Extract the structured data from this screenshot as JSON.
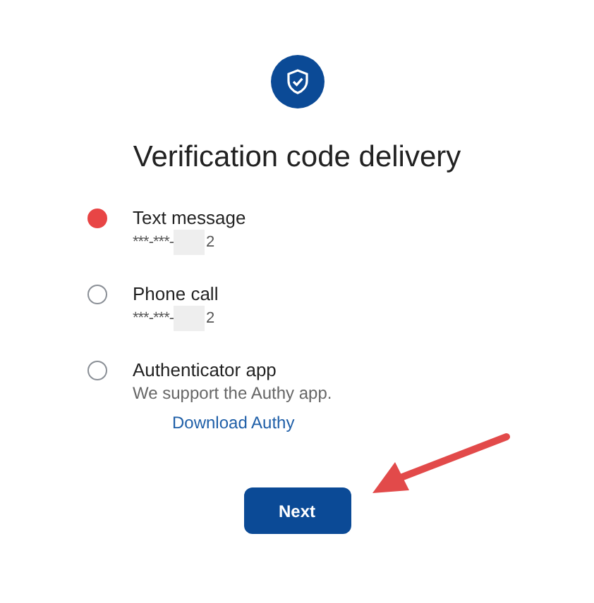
{
  "title": "Verification code delivery",
  "options": [
    {
      "label": "Text message",
      "selected": true,
      "detail": {
        "prefix": "***-***-",
        "redacted": true,
        "suffix": "2"
      }
    },
    {
      "label": "Phone call",
      "selected": false,
      "detail": {
        "prefix": "***-***-",
        "redacted": true,
        "suffix": "2"
      }
    },
    {
      "label": "Authenticator app",
      "selected": false,
      "note": "We support the Authy app.",
      "link": "Download Authy"
    }
  ],
  "button": "Next"
}
